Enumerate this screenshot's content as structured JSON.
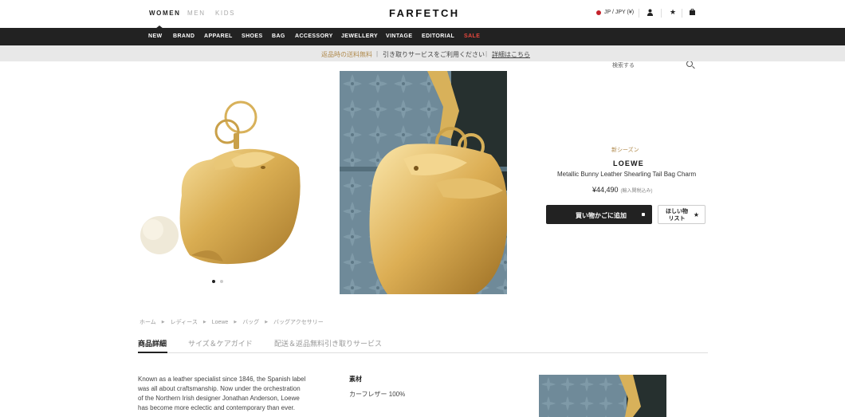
{
  "header": {
    "genders": [
      "WOMEN",
      "MEN",
      "KIDS"
    ],
    "logo": "FARFETCH",
    "region": "JP / JPY (¥)",
    "icons": [
      "account-icon",
      "wishlist-icon",
      "bag-icon"
    ]
  },
  "nav": {
    "items": [
      "NEW",
      "BRAND",
      "APPAREL",
      "SHOES",
      "BAG",
      "ACCESSORY",
      "JEWELLERY",
      "VINTAGE",
      "EDITORIAL",
      "SALE"
    ],
    "search_placeholder": "検索する"
  },
  "promo": {
    "part1": "返品時の送料無料",
    "part2": "引き取りサービスをご利用ください",
    "link": "詳細はこちら",
    "separator": "|"
  },
  "product": {
    "season": "新シーズン",
    "brand": "LOEWE",
    "name": "Metallic Bunny Leather Shearling Tail Bag Charm",
    "price": "¥44,490",
    "price_note": "(輸入関税込み)",
    "add_to_bag": "買い物かごに追加",
    "wishlist_line1": "ほしい物",
    "wishlist_line2": "リスト",
    "image_count": 2,
    "active_image": 1
  },
  "breadcrumb": [
    "ホーム",
    "レディース",
    "Loewe",
    "バッグ",
    "バッグアクセサリー"
  ],
  "tabs": [
    "商品詳細",
    "サイズ＆ケアガイド",
    "配送＆返品無料引き取りサービス"
  ],
  "details": {
    "description_lines": [
      "Known as a leather specialist since 1846, the Spanish label",
      "was all about craftsmanship. Now under the orchestration",
      "of the Northern Irish designer Jonathan Anderson, Loewe",
      "has become more eclectic and contemporary than ever."
    ],
    "material_heading": "素材",
    "material_value": "カーフレザー 100%"
  },
  "colors": {
    "nav_bg": "#222222",
    "sale": "#e8473d",
    "season": "#b08a4d",
    "leather_gold": "#d8b15a",
    "bag_blue": "#6f8a99"
  }
}
